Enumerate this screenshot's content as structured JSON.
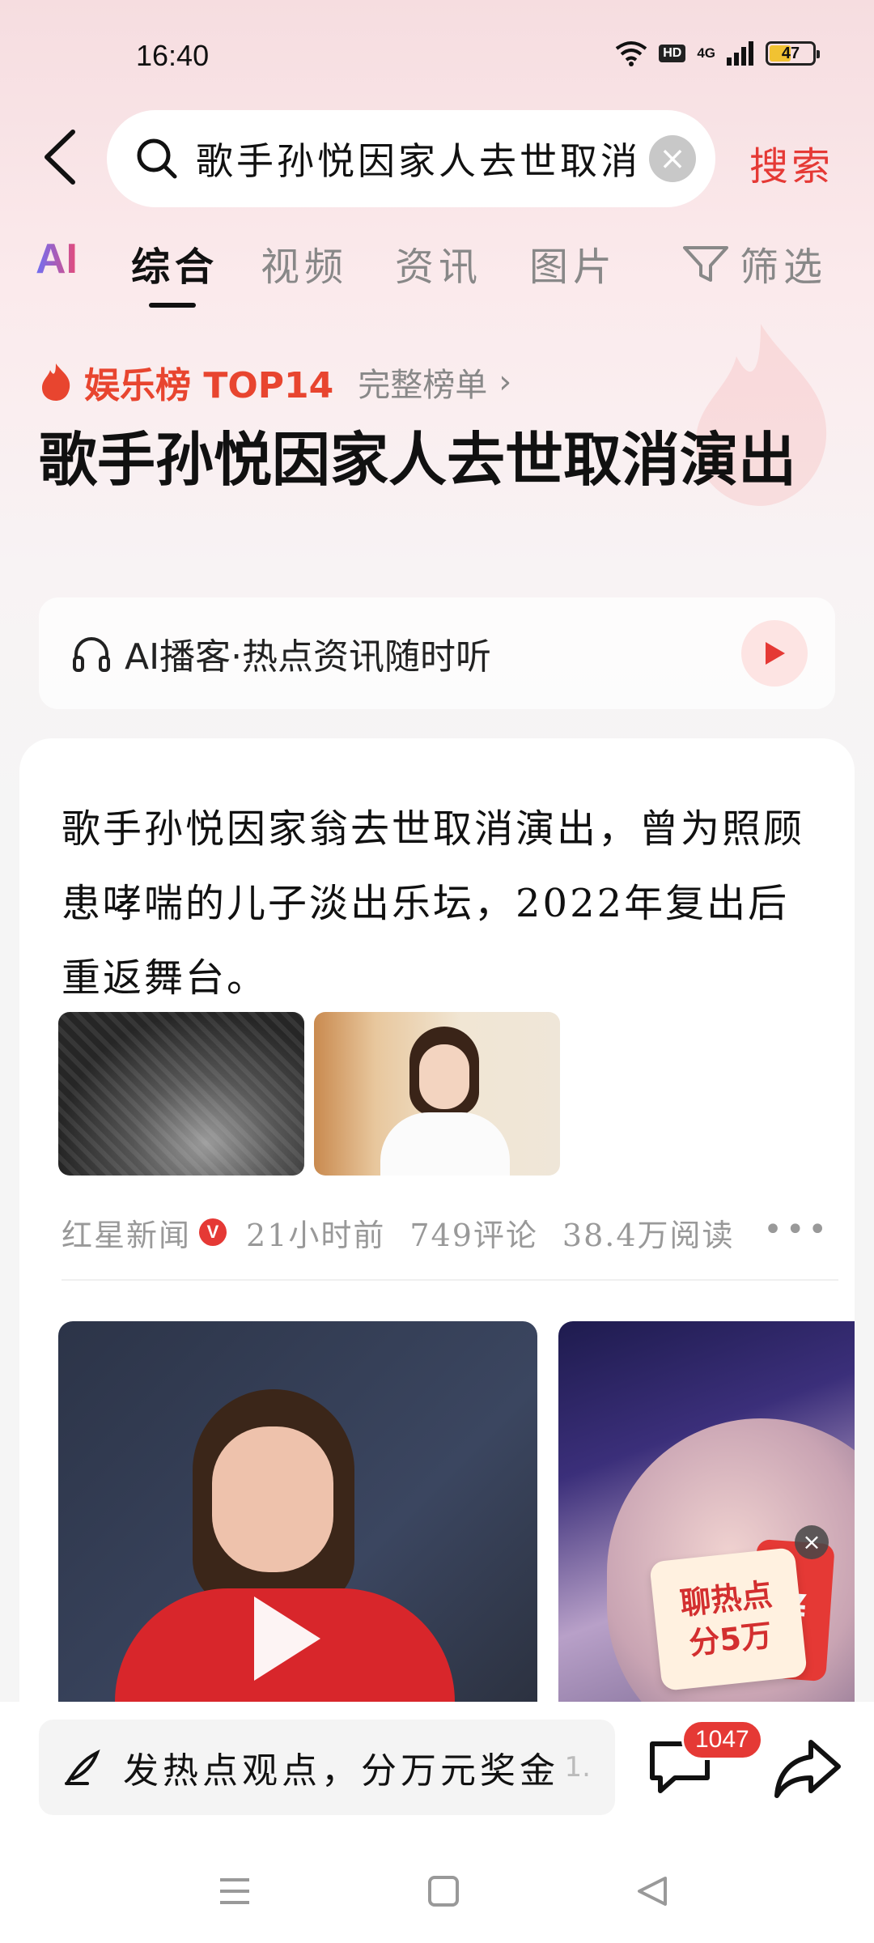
{
  "status_bar": {
    "time": "16:40",
    "hd_label": "HD",
    "network_label": "4G",
    "battery_level": "47"
  },
  "search": {
    "query": "歌手孙悦因家人去世取消演出",
    "action_label": "搜索"
  },
  "tabs": {
    "ai_label": "AI",
    "items": [
      "综合",
      "视频",
      "资讯",
      "图片"
    ],
    "active_index": 0,
    "filter_label": "筛选"
  },
  "hot_rank": {
    "label": "娱乐榜 TOP14",
    "full_list_label": "完整榜单",
    "title": "歌手孙悦因家人去世取消演出"
  },
  "podcast": {
    "label": "AI播客·热点资讯随时听"
  },
  "news_card": {
    "summary": "歌手孙悦因家翁去世取消演出，曾为照顾患哮喘的儿子淡出乐坛，2022年复出后重返舞台。",
    "source": "红星新闻",
    "verified_mark": "V",
    "time_ago": "21小时前",
    "comments": "749评论",
    "reads": "38.4万阅读"
  },
  "promo": {
    "line1": "聊热点",
    "line2": "分5万",
    "currency": "¥"
  },
  "bottom_bar": {
    "comment_placeholder": "发热点观点，分万元奖金",
    "comment_fade": "1.",
    "comment_count": "1047"
  },
  "colors": {
    "accent_red": "#e53935",
    "rank_orange": "#e8452f",
    "background": "#f5f5f5"
  }
}
